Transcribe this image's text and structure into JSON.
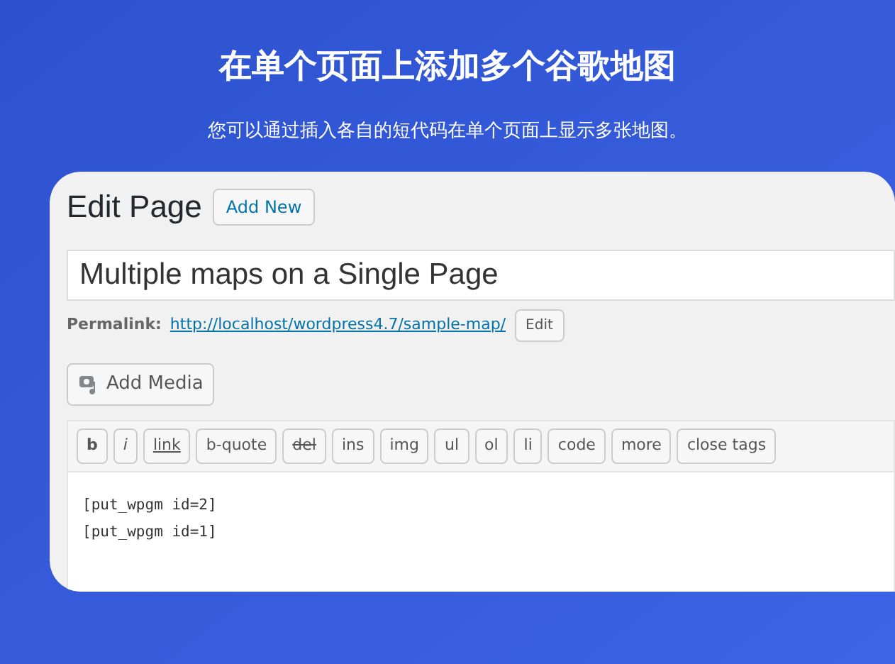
{
  "heading": "在单个页面上添加多个谷歌地图",
  "subheading": "您可以通过插入各自的短代码在单个页面上显示多张地图。",
  "editor": {
    "title": "Edit Page",
    "add_new": "Add New",
    "post_title": "Multiple maps on a Single Page",
    "permalink_label": "Permalink:",
    "permalink_url": "http://localhost/wordpress4.7/sample-map/",
    "permalink_edit": "Edit",
    "add_media": "Add Media",
    "toolbar": [
      {
        "label": "b",
        "kind": "bold"
      },
      {
        "label": "i",
        "kind": "italic"
      },
      {
        "label": "link",
        "kind": "link"
      },
      {
        "label": "b-quote",
        "kind": "plain"
      },
      {
        "label": "del",
        "kind": "strike"
      },
      {
        "label": "ins",
        "kind": "plain"
      },
      {
        "label": "img",
        "kind": "plain"
      },
      {
        "label": "ul",
        "kind": "plain"
      },
      {
        "label": "ol",
        "kind": "plain"
      },
      {
        "label": "li",
        "kind": "plain"
      },
      {
        "label": "code",
        "kind": "plain"
      },
      {
        "label": "more",
        "kind": "plain"
      },
      {
        "label": "close tags",
        "kind": "plain"
      }
    ],
    "content_lines": [
      "[put_wpgm id=2]",
      "[put_wpgm id=1]"
    ]
  }
}
